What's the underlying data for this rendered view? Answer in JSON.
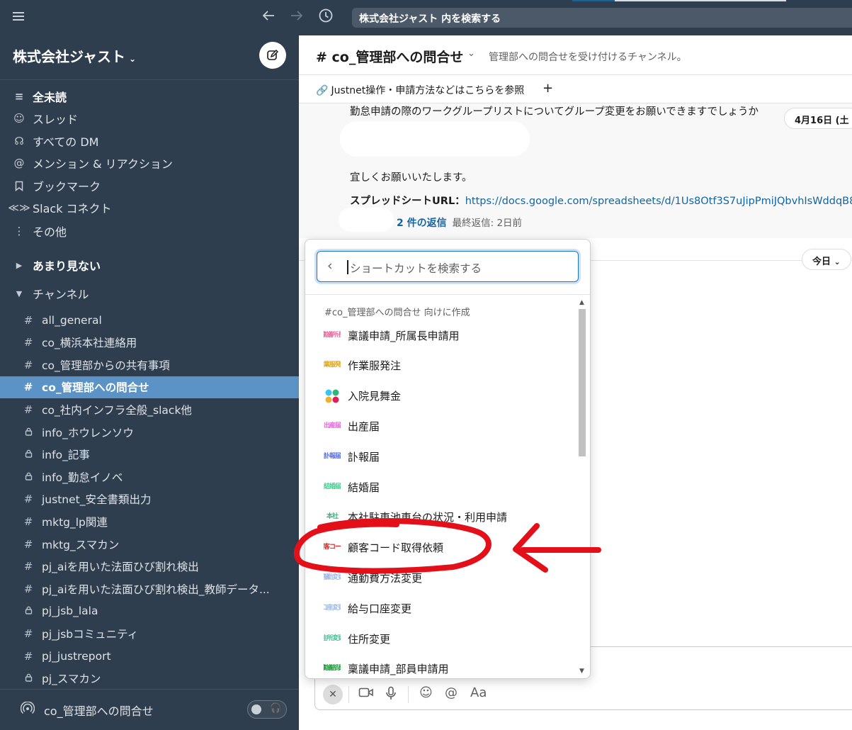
{
  "topbar": {
    "search_text": "株式会社ジャスト 内を検索する",
    "icons": [
      "menu-icon",
      "back-arrow-icon",
      "forward-arrow-icon",
      "history-icon"
    ]
  },
  "sidebar": {
    "workspace_name": "株式会社ジャスト",
    "nav": [
      {
        "label": "全未読",
        "icon": "unreads-icon"
      },
      {
        "label": "スレッド",
        "icon": "threads-icon"
      },
      {
        "label": "すべての DM",
        "icon": "dm-icon"
      },
      {
        "label": "メンション & リアクション",
        "icon": "mention-icon"
      },
      {
        "label": "ブックマーク",
        "icon": "bookmark-icon"
      },
      {
        "label": "Slack コネクト",
        "icon": "connect-icon"
      },
      {
        "label": "その他",
        "icon": "more-icon"
      }
    ],
    "section_rarely": "あまり見ない",
    "section_channels": "チャンネル",
    "channels": [
      {
        "name": "all_general",
        "private": false,
        "active": false
      },
      {
        "name": "co_横浜本社連絡用",
        "private": false,
        "active": false
      },
      {
        "name": "co_管理部からの共有事項",
        "private": false,
        "active": false
      },
      {
        "name": "co_管理部への問合せ",
        "private": false,
        "active": true
      },
      {
        "name": "co_社内インフラ全般_slack他",
        "private": false,
        "active": false
      },
      {
        "name": "info_ホウレンソウ",
        "private": true,
        "active": false
      },
      {
        "name": "info_記事",
        "private": true,
        "active": false
      },
      {
        "name": "info_勤怠イノベ",
        "private": true,
        "active": false
      },
      {
        "name": "justnet_安全書類出力",
        "private": false,
        "active": false
      },
      {
        "name": "mktg_lp関連",
        "private": false,
        "active": false
      },
      {
        "name": "mktg_スマカン",
        "private": false,
        "active": false
      },
      {
        "name": "pj_aiを用いた法面ひび割れ検出",
        "private": false,
        "active": false
      },
      {
        "name": "pj_aiを用いた法面ひび割れ検出_教師データ...",
        "private": false,
        "active": false
      },
      {
        "name": "pj_jsb_lala",
        "private": true,
        "active": false
      },
      {
        "name": "pj_jsbコミュニティ",
        "private": false,
        "active": false
      },
      {
        "name": "pj_justreport",
        "private": false,
        "active": false
      },
      {
        "name": "pj_スマカン",
        "private": true,
        "active": false
      }
    ],
    "huddle_label": "co_管理部への問合せ"
  },
  "channel": {
    "title": "# co_管理部への問合せ",
    "topic": "管理部への問合せを受け付けるチャンネル。",
    "bookmark": "Justnet操作・申請方法などはこちらを参照",
    "bookmark_add": "+"
  },
  "message": {
    "line1": "勤怠申請の際のワークグループリストについてグループ変更をお願いできますでしょうか",
    "line2": "宜しくお願いいたします。",
    "sheet_label": "スプレッドシートURL：",
    "sheet_url": "https://docs.google.com/spreadsheets/d/1Us8Otf3S7uJipPmiJQbvhIsWddqB8",
    "reply_count": "2 件の返信",
    "last_reply": "最終返信: 2日前",
    "date_pill_1": "4月16日 (土",
    "date_pill_2": "今日"
  },
  "shortcut_popup": {
    "placeholder": "ショートカットを検索する",
    "category": "#co_管理部への問合せ 向けに作成",
    "items": [
      {
        "label": "稟議申請_所属長申請用",
        "icon_text": "稟議所長",
        "color": "#e96aa0"
      },
      {
        "label": "作業服発注",
        "icon_text": "作業服発注",
        "color": "#e0a21a"
      },
      {
        "label": "入院見舞金",
        "icon_text": "",
        "color": "#3aa757"
      },
      {
        "label": "出産届",
        "icon_text": "出産届",
        "color": "#e066d6"
      },
      {
        "label": "訃報届",
        "icon_text": "訃報届",
        "color": "#5b6fd6"
      },
      {
        "label": "結婚届",
        "icon_text": "結婚届",
        "color": "#3fcf8e"
      },
      {
        "label": "本社駐車池車台の状況・利用申請",
        "icon_text": "本社",
        "color": "#2eb67d"
      },
      {
        "label": "顧客コード取得依頼",
        "icon_text": "顧客コード",
        "color": "#e01e1e"
      },
      {
        "label": "通勤費方法変更",
        "icon_text": "通勤変更",
        "color": "#9fb8e8"
      },
      {
        "label": "給与口座変更",
        "icon_text": "口座変更",
        "color": "#9fb8e8"
      },
      {
        "label": "住所変更",
        "icon_text": "住所変更",
        "color": "#4dbb93"
      },
      {
        "label": "稟議申請_部員申請用",
        "icon_text": "稟議部員",
        "color": "#1d9b3a"
      }
    ]
  },
  "composer": {
    "font_button": "Aa"
  },
  "colors": {
    "sidebar_bg": "#2f3e4e",
    "active_channel": "#5b93c7",
    "link": "#1264a3",
    "annotation_red": "#e3101a"
  }
}
